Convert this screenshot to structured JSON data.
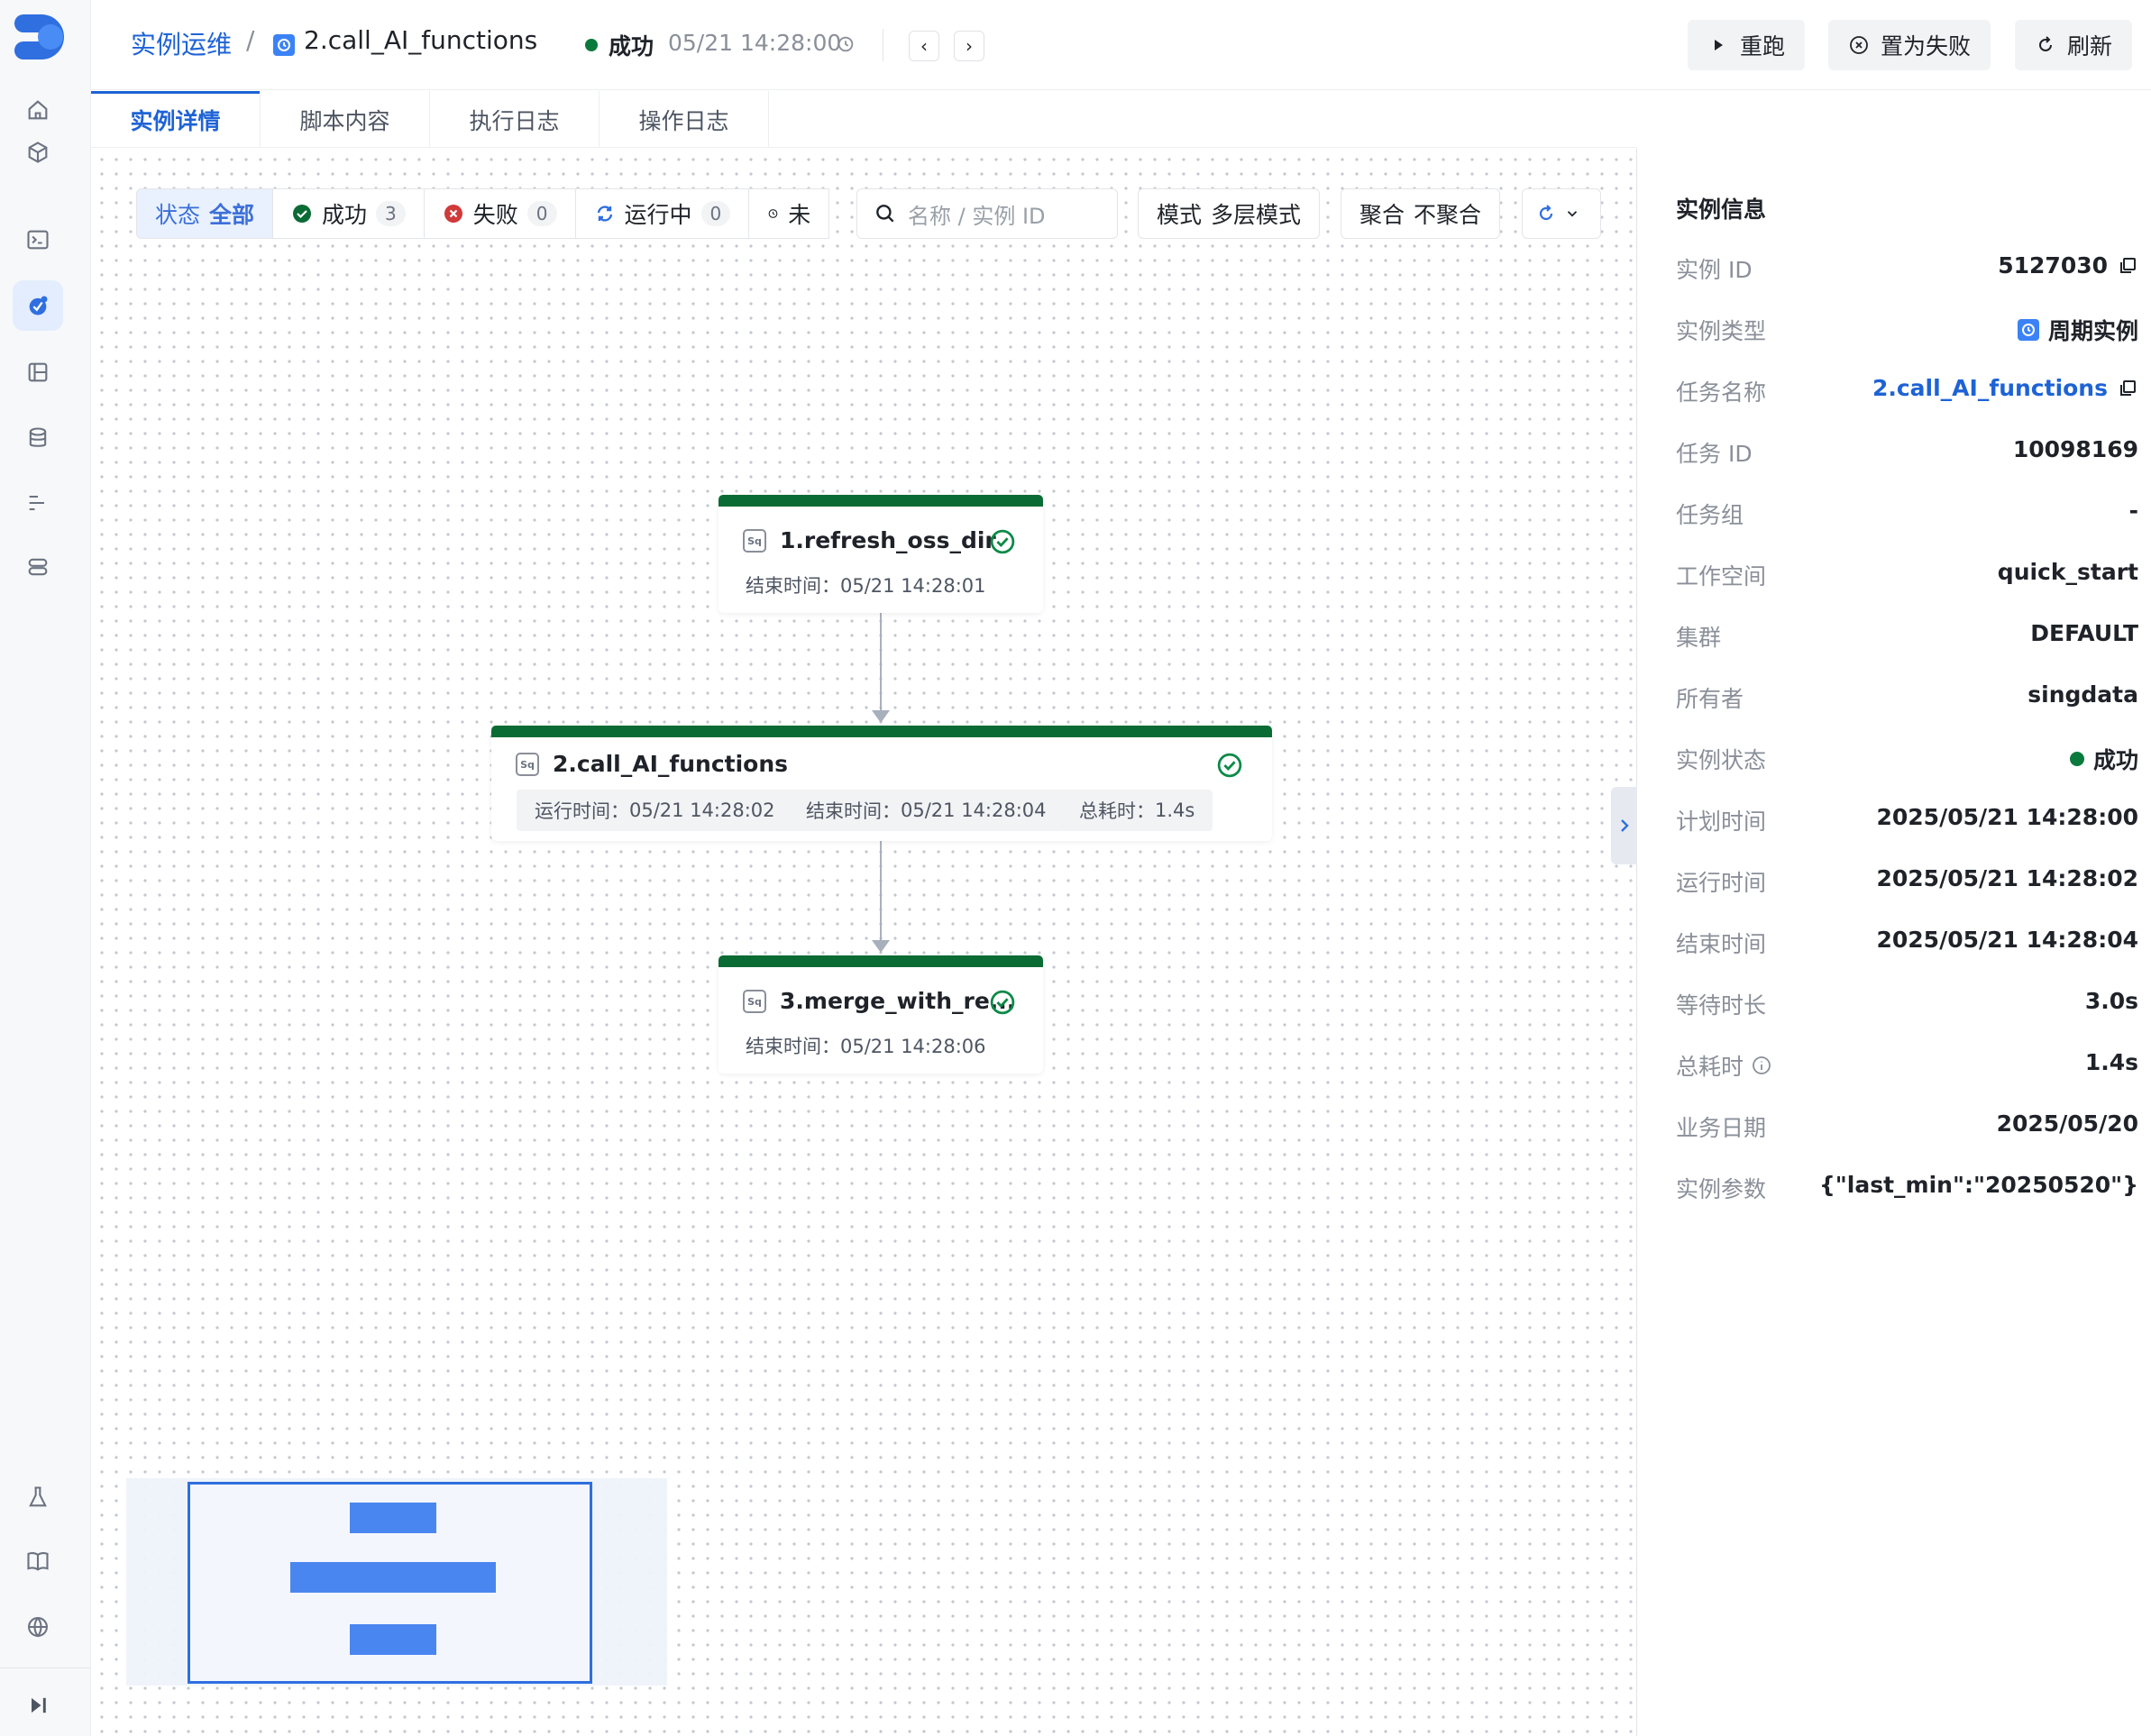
{
  "colors": {
    "accent": "#1e63d6",
    "success": "#0b6b35",
    "danger": "#d03a3a",
    "minimap": "#4a86f0"
  },
  "nav": {
    "items": [
      "home-icon",
      "package-icon",
      "terminal-icon",
      "ops-icon",
      "book-icon",
      "database-icon",
      "list-icon",
      "storage-icon",
      "flask-icon",
      "docs-icon",
      "globe-icon",
      "collapse-icon"
    ],
    "active": "ops-icon"
  },
  "header": {
    "breadcrumb_root": "实例运维",
    "breadcrumb_sep": "/",
    "task_name": "2.call_AI_functions",
    "status": "成功",
    "time": "05/21 14:28:00",
    "prev": "‹",
    "next": "›",
    "buttons": {
      "rerun": "重跑",
      "set_failed": "置为失败",
      "refresh": "刷新"
    }
  },
  "tabs": [
    "实例详情",
    "脚本内容",
    "执行日志",
    "操作日志"
  ],
  "toolbar": {
    "status_label": "状态",
    "status_all": "全部",
    "success_label": "成功",
    "success_count": "3",
    "failed_label": "失败",
    "failed_count": "0",
    "running_label": "运行中",
    "running_count": "0",
    "pending_label": "未",
    "search_placeholder": "名称 / 实例 ID",
    "mode_label": "模式",
    "mode_value": "多层模式",
    "agg_label": "聚合",
    "agg_value": "不聚合"
  },
  "dag": {
    "nodes": [
      {
        "name": "1.refresh_oss_dir",
        "type": "Sq",
        "end_label": "结束时间：",
        "end": "05/21 14:28:01"
      },
      {
        "name": "2.call_AI_functions",
        "type": "Sq",
        "run_label": "运行时间：",
        "run": "05/21 14:28:02",
        "end_label": "结束时间：",
        "end": "05/21 14:28:04",
        "cost_label": "总耗时：",
        "cost": "1.4s"
      },
      {
        "name": "3.merge_with_re...",
        "type": "Sq",
        "end_label": "结束时间：",
        "end": "05/21 14:28:06"
      }
    ]
  },
  "panel": {
    "title": "实例信息",
    "rows": [
      {
        "label": "实例 ID",
        "value": "5127030"
      },
      {
        "label": "实例类型",
        "value": "周期实例"
      },
      {
        "label": "任务名称",
        "value": "2.call_AI_functions"
      },
      {
        "label": "任务 ID",
        "value": "10098169"
      },
      {
        "label": "任务组",
        "value": "-"
      },
      {
        "label": "工作空间",
        "value": "quick_start"
      },
      {
        "label": "集群",
        "value": "DEFAULT"
      },
      {
        "label": "所有者",
        "value": "singdata"
      },
      {
        "label": "实例状态",
        "value": "成功"
      },
      {
        "label": "计划时间",
        "value": "2025/05/21 14:28:00"
      },
      {
        "label": "运行时间",
        "value": "2025/05/21 14:28:02"
      },
      {
        "label": "结束时间",
        "value": "2025/05/21 14:28:04"
      },
      {
        "label": "等待时长",
        "value": "3.0s"
      },
      {
        "label": "总耗时",
        "value": "1.4s"
      },
      {
        "label": "业务日期",
        "value": "2025/05/20"
      },
      {
        "label": "实例参数",
        "value": "{\"last_min\":\"20250520\"}"
      }
    ]
  }
}
